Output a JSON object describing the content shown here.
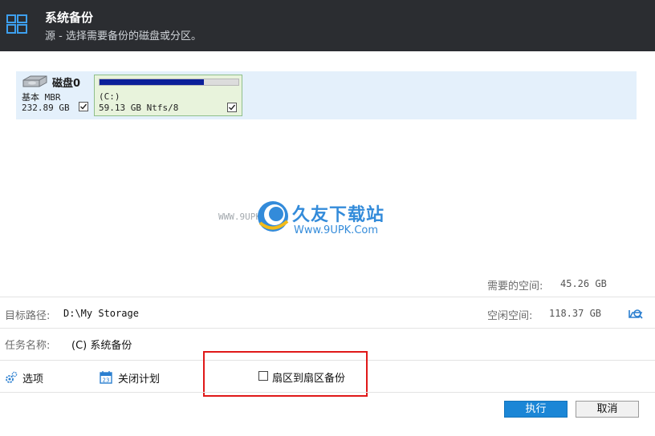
{
  "header": {
    "title": "系统备份",
    "subtitle": "源 - 选择需要备份的磁盘或分区。"
  },
  "disk": {
    "name": "磁盘0",
    "type": "基本 MBR",
    "size": "232.89 GB",
    "checked": true,
    "partition": {
      "letter": "(C:)",
      "info": "59.13 GB Ntfs/8",
      "used_fraction": 0.75,
      "checked": true
    }
  },
  "watermark": {
    "url": "WWW.9UPK.COM",
    "brand": "久友下载站",
    "domain": "Www.9UPK.Com"
  },
  "space": {
    "required_label": "需要的空间:",
    "required_value": "45.26 GB",
    "free_label": "空闲空间:",
    "free_value": "118.37 GB"
  },
  "destination": {
    "label": "目标路径:",
    "value": "D:\\My Storage"
  },
  "task": {
    "label": "任务名称:",
    "value": "(C) 系统备份"
  },
  "options": {
    "options_label": "选项",
    "schedule_label": "关闭计划",
    "sector_label": "扇区到扇区备份"
  },
  "buttons": {
    "run": "执行",
    "cancel": "取消"
  },
  "colors": {
    "header_bg": "#2b2d31",
    "accent": "#1b86d6",
    "highlight": "#e01818"
  }
}
